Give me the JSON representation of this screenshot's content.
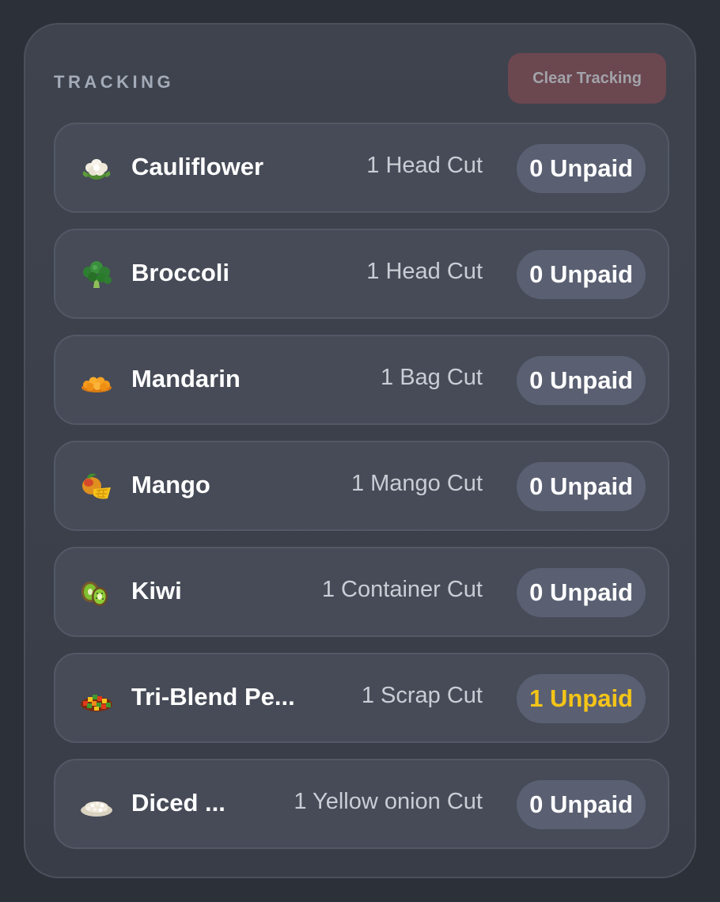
{
  "header": {
    "title": "TRACKING",
    "clear_label": "Clear Tracking"
  },
  "items": [
    {
      "icon": "cauliflower-icon",
      "name": "Cauliflower",
      "cut": "1 Head Cut",
      "unpaid": "0 Unpaid",
      "highlight": false
    },
    {
      "icon": "broccoli-icon",
      "name": "Broccoli",
      "cut": "1 Head Cut",
      "unpaid": "0 Unpaid",
      "highlight": false
    },
    {
      "icon": "mandarin-icon",
      "name": "Mandarin",
      "cut": "1 Bag Cut",
      "unpaid": "0 Unpaid",
      "highlight": false
    },
    {
      "icon": "mango-icon",
      "name": "Mango",
      "cut": "1 Mango Cut",
      "unpaid": "0 Unpaid",
      "highlight": false
    },
    {
      "icon": "kiwi-icon",
      "name": "Kiwi",
      "cut": "1 Container Cut",
      "unpaid": "0 Unpaid",
      "highlight": false
    },
    {
      "icon": "tri-blend-peppers-icon",
      "name": "Tri-Blend Pe...",
      "cut": "1 Scrap Cut",
      "unpaid": "1 Unpaid",
      "highlight": true
    },
    {
      "icon": "diced-onion-icon",
      "name": "Diced ...",
      "cut": "1 Yellow onion Cut",
      "unpaid": "0 Unpaid",
      "highlight": false
    }
  ],
  "colors": {
    "background": "#2c3039",
    "panel": "#3e434d",
    "row": "#464b57",
    "badge": "#5a6072",
    "warning": "#f5c518",
    "danger_button": "#6b4750"
  }
}
